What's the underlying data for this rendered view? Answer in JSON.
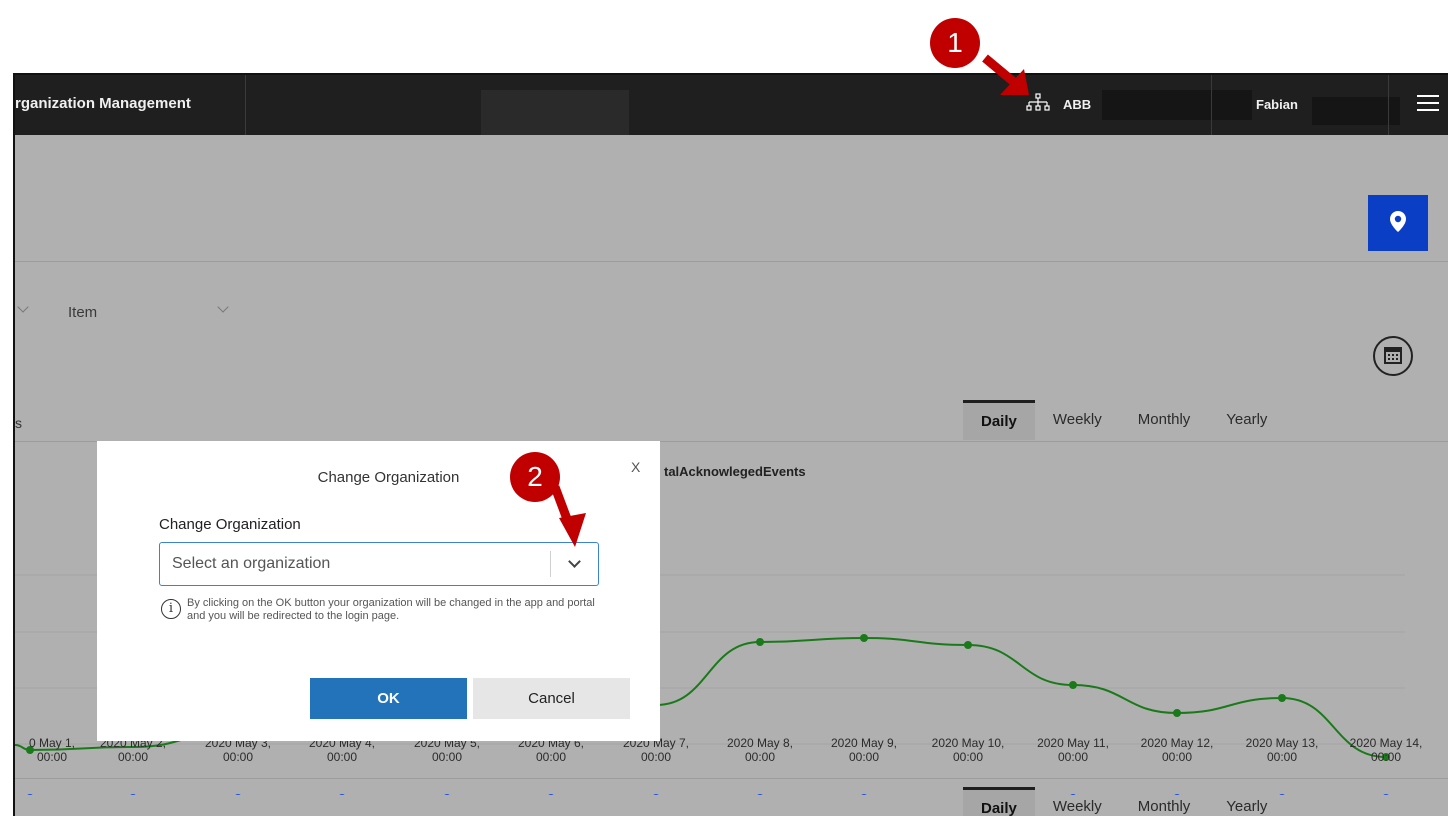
{
  "topbar": {
    "app_title": "rganization Management",
    "org_name": "ABB",
    "user_name": "Fabian"
  },
  "filters": {
    "item_label": "Item"
  },
  "partial_label": "s",
  "period_tabs": [
    "Daily",
    "Weekly",
    "Monthly",
    "Yearly"
  ],
  "chart": {
    "legend_label": "talAcknowlegedEvents",
    "x_labels": [
      "0 May 1,",
      "2020 May 2,",
      "2020 May 3,",
      "2020 May 4,",
      "2020 May 5,",
      "2020 May 6,",
      "2020 May 7,",
      "2020 May 8,",
      "2020 May 9,",
      "2020 May 10,",
      "2020 May 11,",
      "2020 May 12,",
      "2020 May 13,",
      "2020 May 14,"
    ],
    "x_time": "00:00",
    "colors": {
      "green_series": "#1a7a1a",
      "blue_series": "#1a4ed8"
    }
  },
  "modal": {
    "title": "Change Organization",
    "close_label": "X",
    "field_label": "Change Organization",
    "select_placeholder": "Select an organization",
    "info_text": "By clicking on the OK button your organization will be changed in the app and portal and you will be redirected to the login page.",
    "ok_label": "OK",
    "cancel_label": "Cancel"
  },
  "annotations": {
    "badge_1": "1",
    "badge_2": "2",
    "color": "#c00000"
  }
}
